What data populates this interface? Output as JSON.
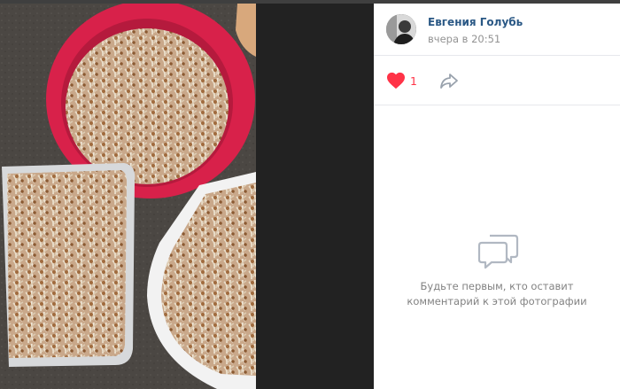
{
  "post": {
    "author_name": "Евгения Голубь",
    "time": "вчера в 20:51",
    "likes": "1"
  },
  "comments": {
    "empty_message": "Будьте первым, кто оставит\nкомментарий к этой фотографии"
  },
  "icons": {
    "like": "heart-icon",
    "share": "share-arrow-icon",
    "empty": "speech-bubbles-icon"
  },
  "colors": {
    "link": "#2a5885",
    "like": "#ff3347",
    "muted": "#828282",
    "icon_gray": "#b1b8c2"
  }
}
